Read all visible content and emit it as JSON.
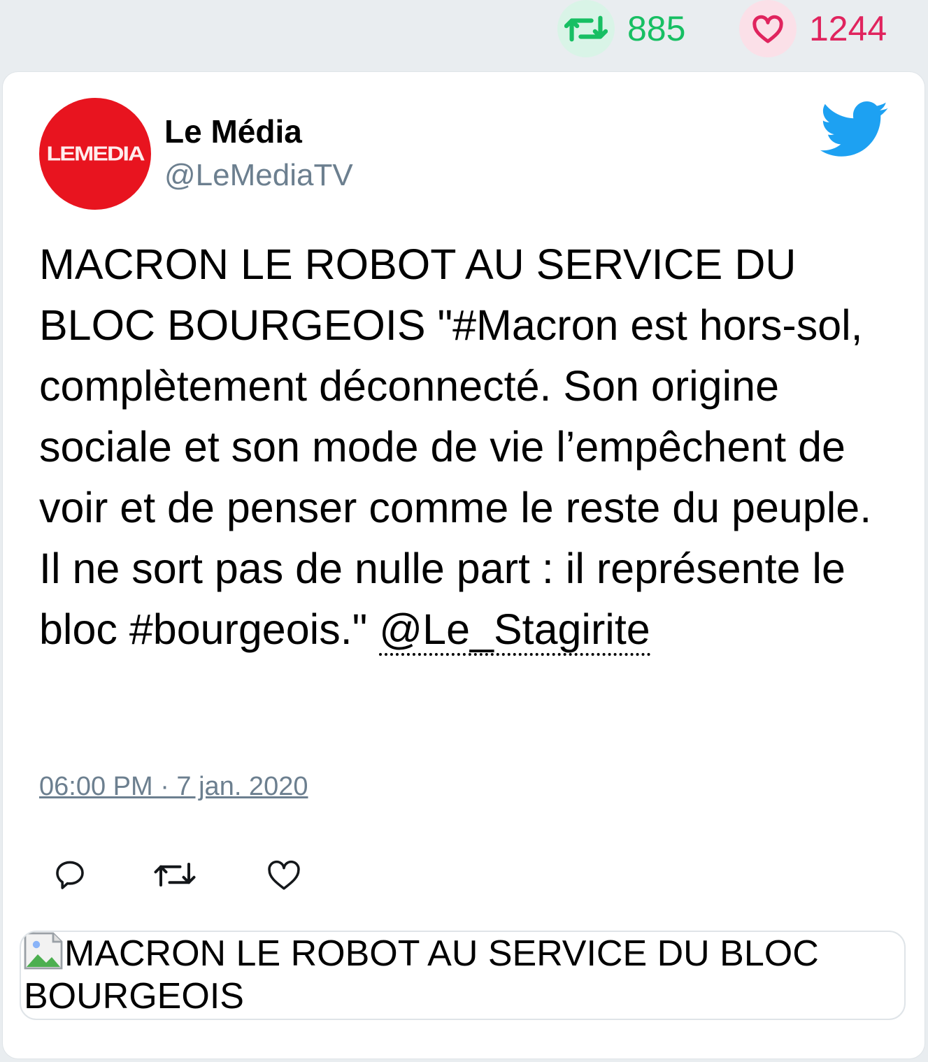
{
  "stats": {
    "retweet_count": "885",
    "like_count": "1244",
    "retweet_icon": "retweet-icon",
    "like_icon": "heart-icon"
  },
  "tweet": {
    "author": {
      "name": "Le Média",
      "handle": "@LeMediaTV",
      "avatar_text": "LEMEDIA"
    },
    "text_before_mention": "MACRON LE ROBOT AU SERVICE DU BLOC BOURGEOIS \"#Macron est hors-sol, complètement déconnecté. Son origine sociale et son mode de vie l’empêchent de voir et de penser comme le reste du peuple. Il ne sort pas de nulle part : il représente le bloc #bourgeois.\"",
    "mention": "@Le_Stagirite",
    "timestamp": "06:00 PM · 7 jan. 2020",
    "link_preview_alt": "MACRON LE ROBOT AU SERVICE DU BLOC BOURGEOIS"
  },
  "colors": {
    "retweet_green": "#17bf63",
    "like_red": "#e0245e",
    "twitter_blue": "#1da1f2",
    "avatar_red": "#e8141f",
    "secondary_text": "#6c7f8f"
  },
  "icons": [
    "twitter-bird-icon",
    "reply-icon",
    "retweet-icon",
    "heart-icon",
    "broken-image-icon"
  ]
}
